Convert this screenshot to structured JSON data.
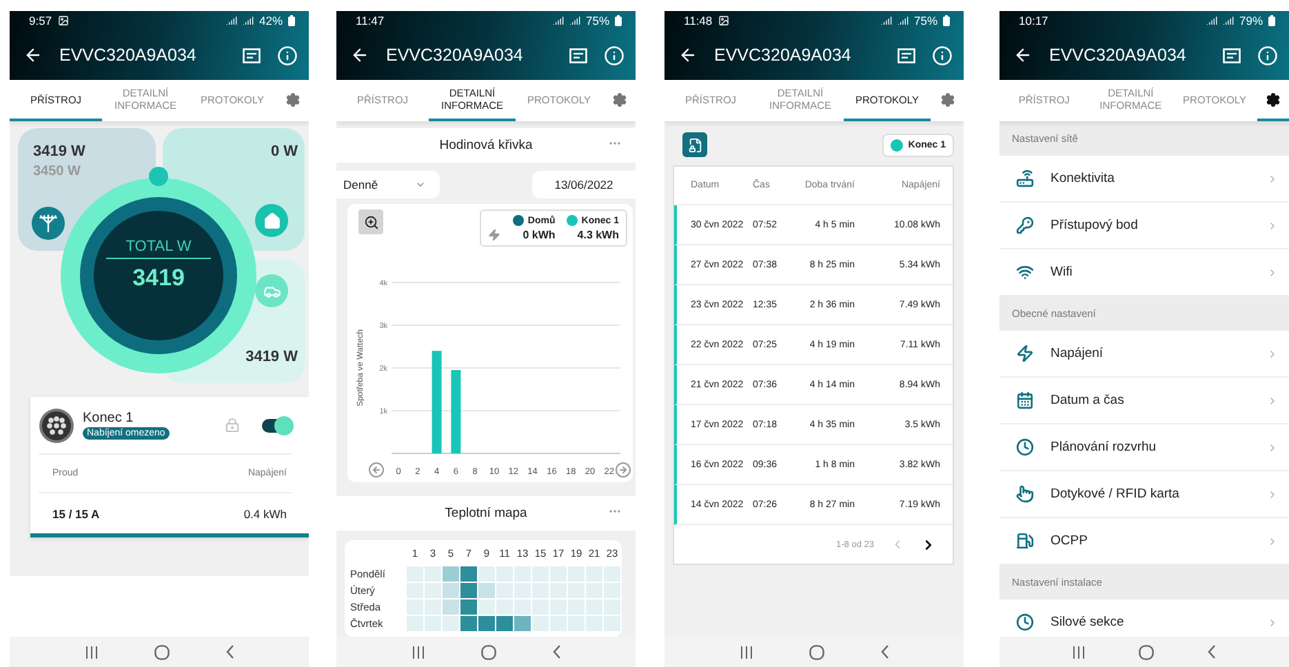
{
  "screens": [
    {
      "kind": "device",
      "status": {
        "time": "9:57",
        "photo": true,
        "battery": "42%"
      },
      "title": "EVVC320A9A034",
      "tabs": [
        {
          "kind": "text",
          "label": "PŘÍSTROJ",
          "selected": true
        },
        {
          "kind": "text",
          "label": "DETAILNÍ INFORMACE",
          "selected": false
        },
        {
          "kind": "text",
          "label": "PROTOKOLY",
          "selected": false
        },
        {
          "kind": "gear",
          "selected": false
        }
      ],
      "grid": {
        "power": "3419 W",
        "limit": "3450 W"
      },
      "home": {
        "power": "0 W"
      },
      "car": {
        "power": "3419 W"
      },
      "total": {
        "label": "TOTAL W",
        "value": "3419"
      },
      "connector": {
        "name": "Konec 1",
        "badge": "Nabíjení omezeno",
        "on": true,
        "columns": [
          "Proud",
          "Napájení"
        ],
        "values": [
          "15 / 15 A",
          "0.4 kWh"
        ]
      }
    },
    {
      "kind": "details",
      "status": {
        "time": "11:47",
        "photo": false,
        "battery": "75%"
      },
      "title": "EVVC320A9A034",
      "tabs": [
        {
          "kind": "text",
          "label": "PŘÍSTROJ",
          "selected": false
        },
        {
          "kind": "text",
          "label": "DETAILNÍ INFORMACE",
          "selected": true
        },
        {
          "kind": "text",
          "label": "PROTOKOLY",
          "selected": false
        },
        {
          "kind": "gear",
          "selected": false
        }
      ],
      "curve_title": "Hodinová křivka",
      "period": "Denně",
      "date": "13/06/2022",
      "totals": [
        "0 kWh",
        "4.3 kWh"
      ],
      "chart_data": {
        "type": "bar",
        "ylabel": "Spotřeba ve Wattech",
        "grid": true,
        "categories": [
          "0",
          "2",
          "4",
          "6",
          "8",
          "10",
          "12",
          "14",
          "16",
          "18",
          "20",
          "22"
        ],
        "series": [
          {
            "name": "Domů",
            "color": "#0e6e80",
            "values": [
              0,
              0,
              0,
              0,
              0,
              0,
              0,
              0,
              0,
              0,
              0,
              0
            ]
          },
          {
            "name": "Konec 1",
            "color": "#17c6b6",
            "values": [
              0,
              0,
              2400,
              1950,
              0,
              0,
              0,
              0,
              0,
              0,
              0,
              0
            ]
          }
        ],
        "ylim": [
          0,
          4000
        ],
        "yticks": [
          {
            "value": 1000,
            "label": "1k"
          },
          {
            "value": 2000,
            "label": "2k"
          },
          {
            "value": 3000,
            "label": "3k"
          },
          {
            "value": 4000,
            "label": "4k"
          }
        ]
      },
      "heatmap": {
        "title": "Teplotní mapa",
        "columns": [
          "1",
          "3",
          "5",
          "7",
          "9",
          "11",
          "13",
          "15",
          "17",
          "19",
          "21",
          "23"
        ],
        "rows": [
          {
            "label": "Pondělí",
            "cells": [
              {
                "color": "#e4f1f3"
              },
              {
                "color": "#e4f1f3"
              },
              {
                "color": "#9dcdd4"
              },
              {
                "color": "#2d8e9c"
              },
              {
                "color": "#e4f1f3"
              },
              {
                "color": "#e4f1f3"
              },
              {
                "color": "#e4f1f3"
              },
              {
                "color": "#e4f1f3"
              },
              {
                "color": "#e4f1f3"
              },
              {
                "color": "#e4f1f3"
              },
              {
                "color": "#e4f1f3"
              },
              {
                "color": "#e4f1f3"
              }
            ]
          },
          {
            "label": "Úterý",
            "cells": [
              {
                "color": "#e4f1f3"
              },
              {
                "color": "#e4f1f3"
              },
              {
                "color": "#c7e3e7"
              },
              {
                "color": "#2d8e9c"
              },
              {
                "color": "#c7e3e7"
              },
              {
                "color": "#e4f1f3"
              },
              {
                "color": "#e4f1f3"
              },
              {
                "color": "#e4f1f3"
              },
              {
                "color": "#e4f1f3"
              },
              {
                "color": "#e4f1f3"
              },
              {
                "color": "#e4f1f3"
              },
              {
                "color": "#e4f1f3"
              }
            ]
          },
          {
            "label": "Středa",
            "cells": [
              {
                "color": "#e4f1f3"
              },
              {
                "color": "#e4f1f3"
              },
              {
                "color": "#c7e3e7"
              },
              {
                "color": "#2d8e9c"
              },
              {
                "color": "#e4f1f3"
              },
              {
                "color": "#e4f1f3"
              },
              {
                "color": "#e4f1f3"
              },
              {
                "color": "#e4f1f3"
              },
              {
                "color": "#e4f1f3"
              },
              {
                "color": "#e4f1f3"
              },
              {
                "color": "#e4f1f3"
              },
              {
                "color": "#e4f1f3"
              }
            ]
          },
          {
            "label": "Čtvrtek",
            "cells": [
              {
                "color": "#e4f1f3"
              },
              {
                "color": "#e4f1f3"
              },
              {
                "color": "#e4f1f3"
              },
              {
                "color": "#2d8e9c"
              },
              {
                "color": "#2d8e9c"
              },
              {
                "color": "#2d8e9c"
              },
              {
                "color": "#6db4bf"
              },
              {
                "color": "#e4f1f3"
              },
              {
                "color": "#e4f1f3"
              },
              {
                "color": "#e4f1f3"
              },
              {
                "color": "#e4f1f3"
              },
              {
                "color": "#e4f1f3"
              }
            ]
          }
        ]
      }
    },
    {
      "kind": "logs",
      "status": {
        "time": "11:48",
        "photo": true,
        "battery": "75%"
      },
      "title": "EVVC320A9A034",
      "tabs": [
        {
          "kind": "text",
          "label": "PŘÍSTROJ",
          "selected": false
        },
        {
          "kind": "text",
          "label": "DETAILNÍ INFORMACE",
          "selected": false
        },
        {
          "kind": "text",
          "label": "PROTOKOLY",
          "selected": true
        },
        {
          "kind": "gear",
          "selected": false
        }
      ],
      "filter": {
        "label": "Konec 1",
        "color": "#17c6b6"
      },
      "columns": [
        "Datum",
        "Čas",
        "Doba trvání",
        "Napájení"
      ],
      "rows": [
        {
          "date": "30 čvn 2022",
          "time": "07:52",
          "duration": "4 h 5 min",
          "energy": "10.08 kWh"
        },
        {
          "date": "27 čvn 2022",
          "time": "07:38",
          "duration": "8 h 25 min",
          "energy": "5.34 kWh"
        },
        {
          "date": "23 čvn 2022",
          "time": "12:35",
          "duration": "2 h 36 min",
          "energy": "7.49 kWh"
        },
        {
          "date": "22 čvn 2022",
          "time": "07:25",
          "duration": "4 h 19 min",
          "energy": "7.11 kWh"
        },
        {
          "date": "21 čvn 2022",
          "time": "07:36",
          "duration": "4 h 14 min",
          "energy": "8.94 kWh"
        },
        {
          "date": "17 čvn 2022",
          "time": "07:18",
          "duration": "4 h 35 min",
          "energy": "3.5 kWh"
        },
        {
          "date": "16 čvn 2022",
          "time": "09:36",
          "duration": "1 h 8 min",
          "energy": "3.82 kWh"
        },
        {
          "date": "14 čvn 2022",
          "time": "07:26",
          "duration": "8 h 27 min",
          "energy": "7.19 kWh"
        }
      ],
      "pagination": {
        "range": "1-8 od 23",
        "prev_disabled": true,
        "next_disabled": false
      }
    },
    {
      "kind": "settings",
      "status": {
        "time": "10:17",
        "photo": false,
        "battery": "79%"
      },
      "title": "EVVC320A9A034",
      "tabs": [
        {
          "kind": "text",
          "label": "PŘÍSTROJ",
          "selected": false
        },
        {
          "kind": "text",
          "label": "DETAILNÍ INFORMACE",
          "selected": false
        },
        {
          "kind": "text",
          "label": "PROTOKOLY",
          "selected": false
        },
        {
          "kind": "gear",
          "selected": true
        }
      ],
      "sections": [
        {
          "title": "Nastavení sítě",
          "items": [
            {
              "kind": "router",
              "label": "Konektivita"
            },
            {
              "kind": "key",
              "label": "Přístupový bod"
            },
            {
              "kind": "wifi",
              "label": "Wifi"
            }
          ]
        },
        {
          "title": "Obecné nastavení",
          "items": [
            {
              "kind": "bolt",
              "label": "Napájení"
            },
            {
              "kind": "calendar",
              "label": "Datum a čas"
            },
            {
              "kind": "clock",
              "label": "Plánování rozvrhu"
            },
            {
              "kind": "touch",
              "label": "Dotykové / RFID karta"
            },
            {
              "kind": "charger",
              "label": "OCPP"
            }
          ]
        },
        {
          "title": "Nastavení instalace",
          "items": [
            {
              "kind": "clock",
              "label": "Silové sekce"
            }
          ]
        }
      ]
    }
  ]
}
